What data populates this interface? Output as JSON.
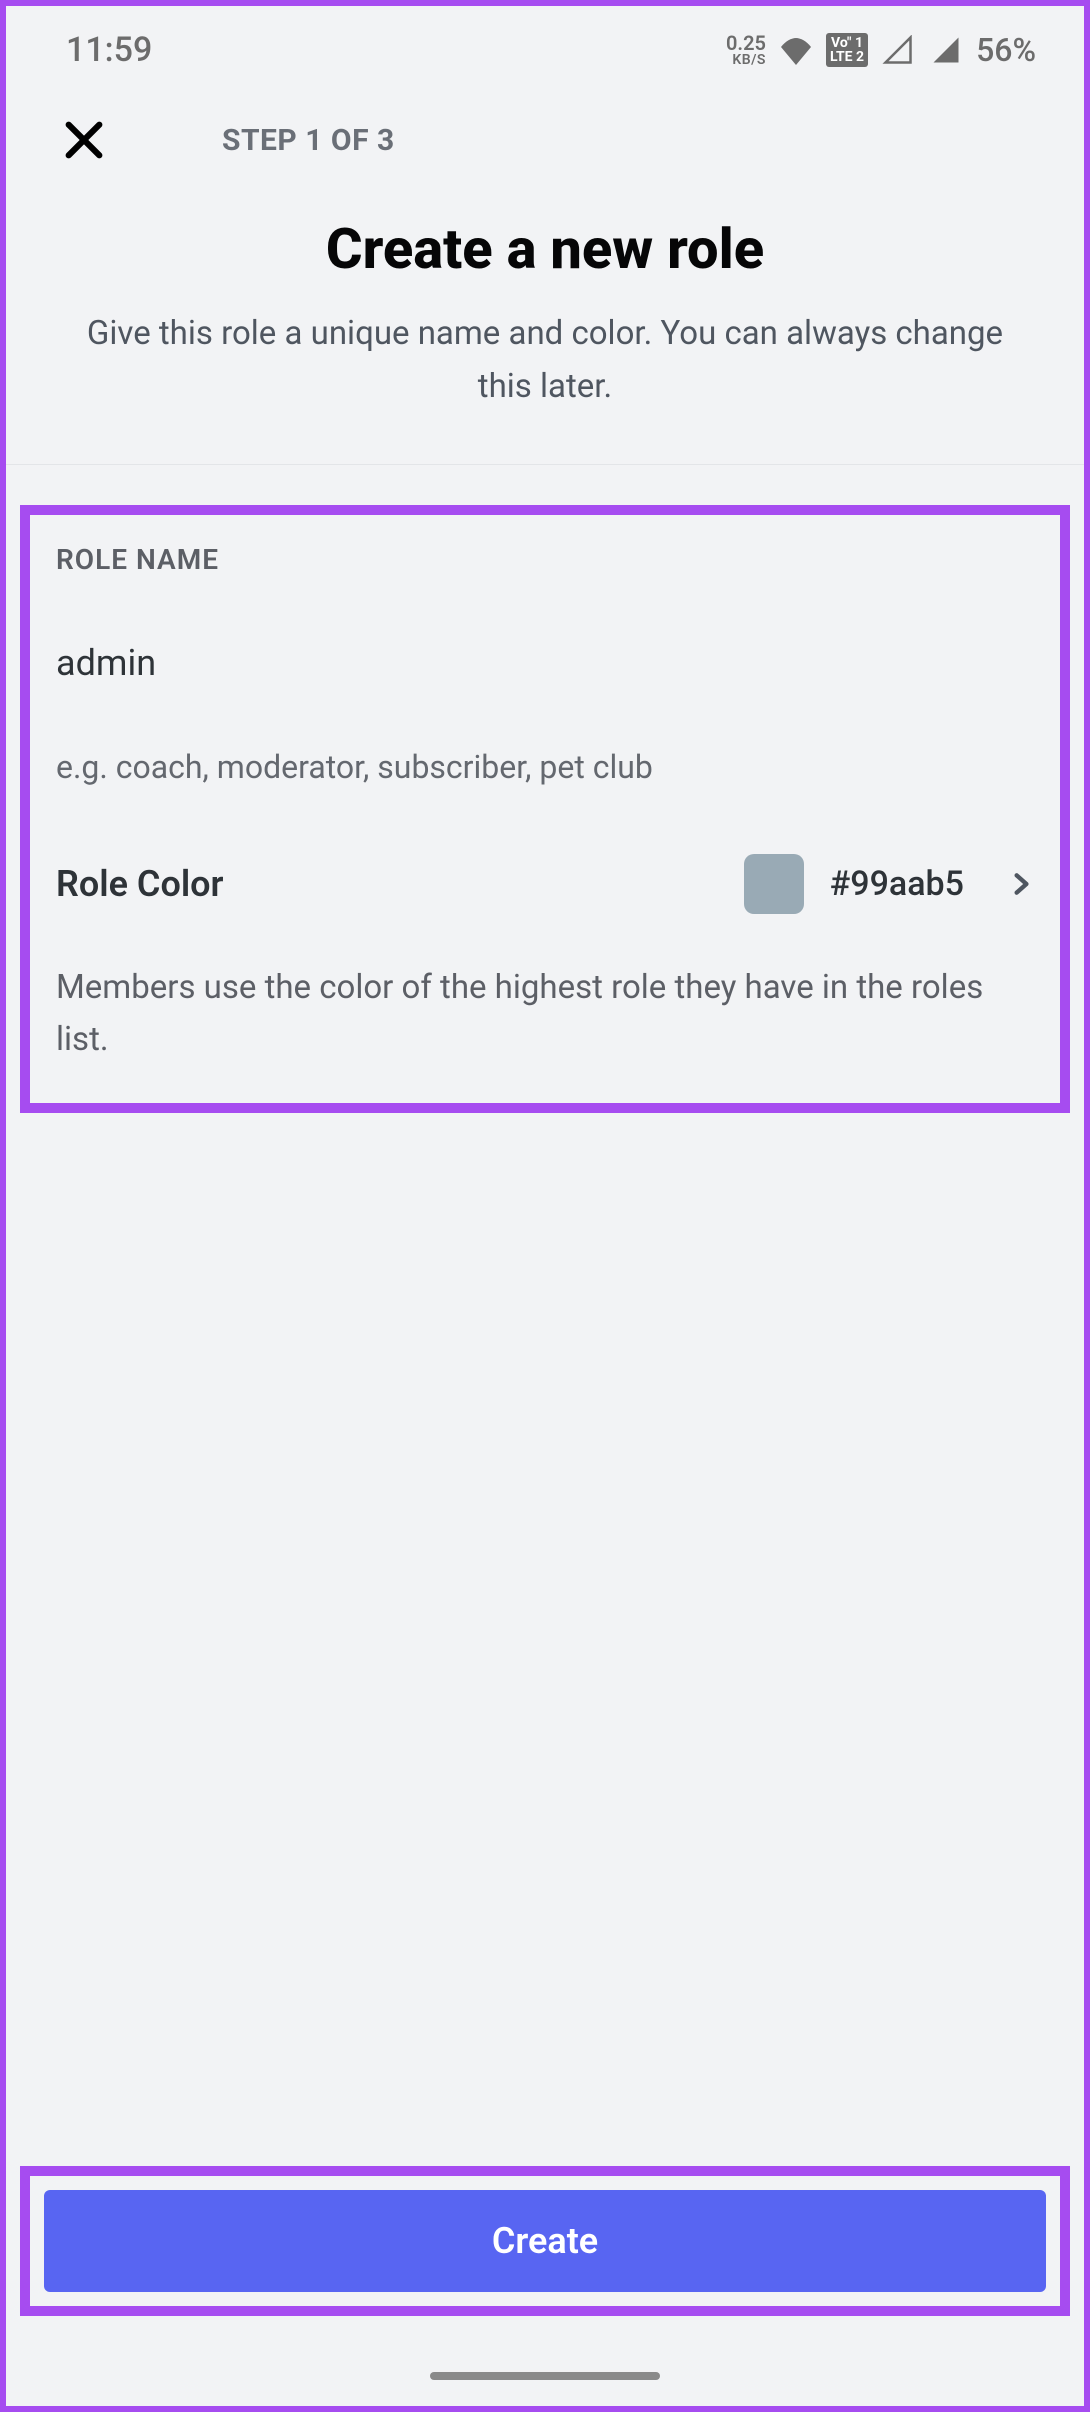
{
  "statusBar": {
    "time": "11:59",
    "speedTop": "0.25",
    "speedBottom": "KB/S",
    "lte": "Vo\" 1\nLTE 2",
    "battery": "56%"
  },
  "header": {
    "step": "STEP 1 OF 3",
    "title": "Create a new role",
    "subtitle": "Give this role a unique name and color. You can always change this later."
  },
  "form": {
    "sectionLabel": "ROLE NAME",
    "roleValue": "admin",
    "hint": "e.g. coach, moderator, subscriber, pet club",
    "colorLabel": "Role Color",
    "colorHex": "#99aab5",
    "colorSwatch": "#99aab5",
    "colorDesc": "Members use the color of the highest role they have in the roles list."
  },
  "footer": {
    "createLabel": "Create"
  }
}
